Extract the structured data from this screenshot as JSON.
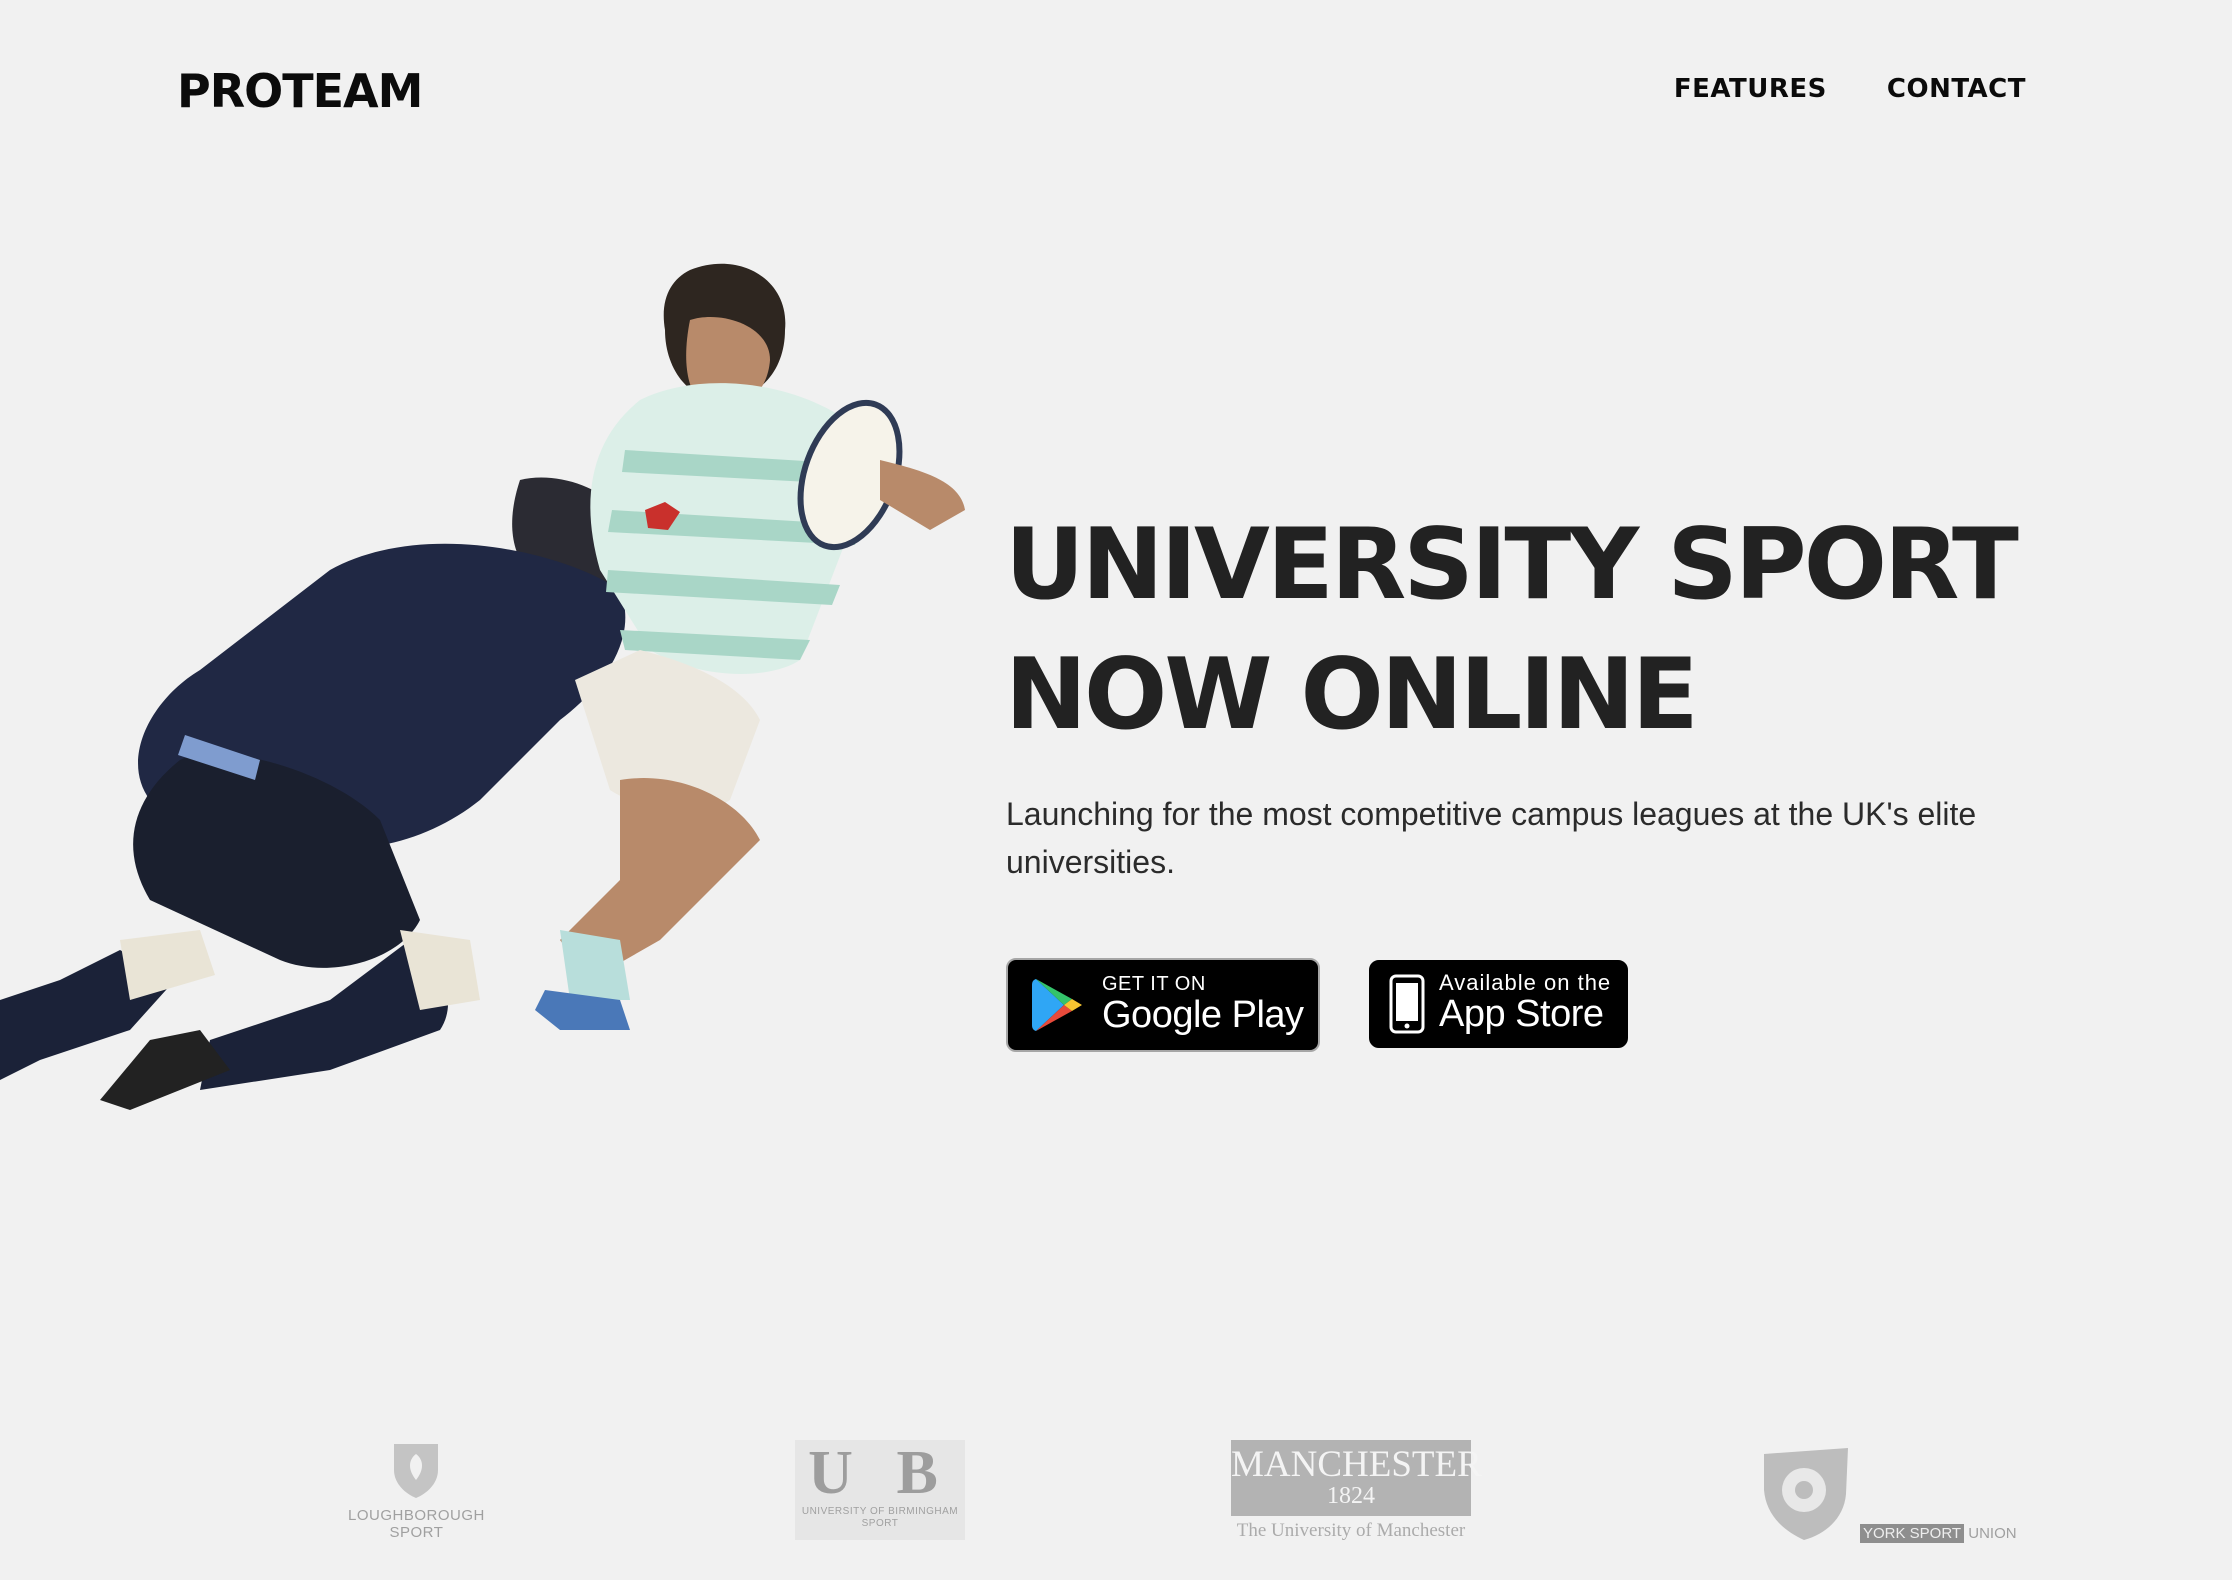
{
  "header": {
    "logo": "PROTEAM",
    "nav": [
      {
        "label": "FEATURES"
      },
      {
        "label": "CONTACT"
      }
    ]
  },
  "hero": {
    "headline_line1": "UNIVERSITY SPORT",
    "headline_line2": "NOW ONLINE",
    "subtitle": "Launching for the most competitive campus leagues at the UK's elite universities.",
    "google_play": {
      "small": "GET IT ON",
      "big": "Google Play"
    },
    "app_store": {
      "small": "Available on the",
      "big": "App Store"
    },
    "image": "rugby-tackle-photo"
  },
  "partners": [
    {
      "name": "loughborough",
      "line1": "LOUGHBOROUGH",
      "line2": "SPORT"
    },
    {
      "name": "birmingham",
      "mark": "U B",
      "line1": "UNIVERSITY OF BIRMINGHAM",
      "line2": "SPORT"
    },
    {
      "name": "manchester",
      "line1": "MANCHESTER",
      "line2": "1824",
      "line3": "The University of Manchester"
    },
    {
      "name": "york",
      "line1": "YORK SPORT",
      "line2": "UNION"
    }
  ],
  "colors": {
    "background": "#f1f1f1",
    "text": "#222222",
    "store_button": "#000000",
    "partner_grey": "#a0a0a0"
  }
}
